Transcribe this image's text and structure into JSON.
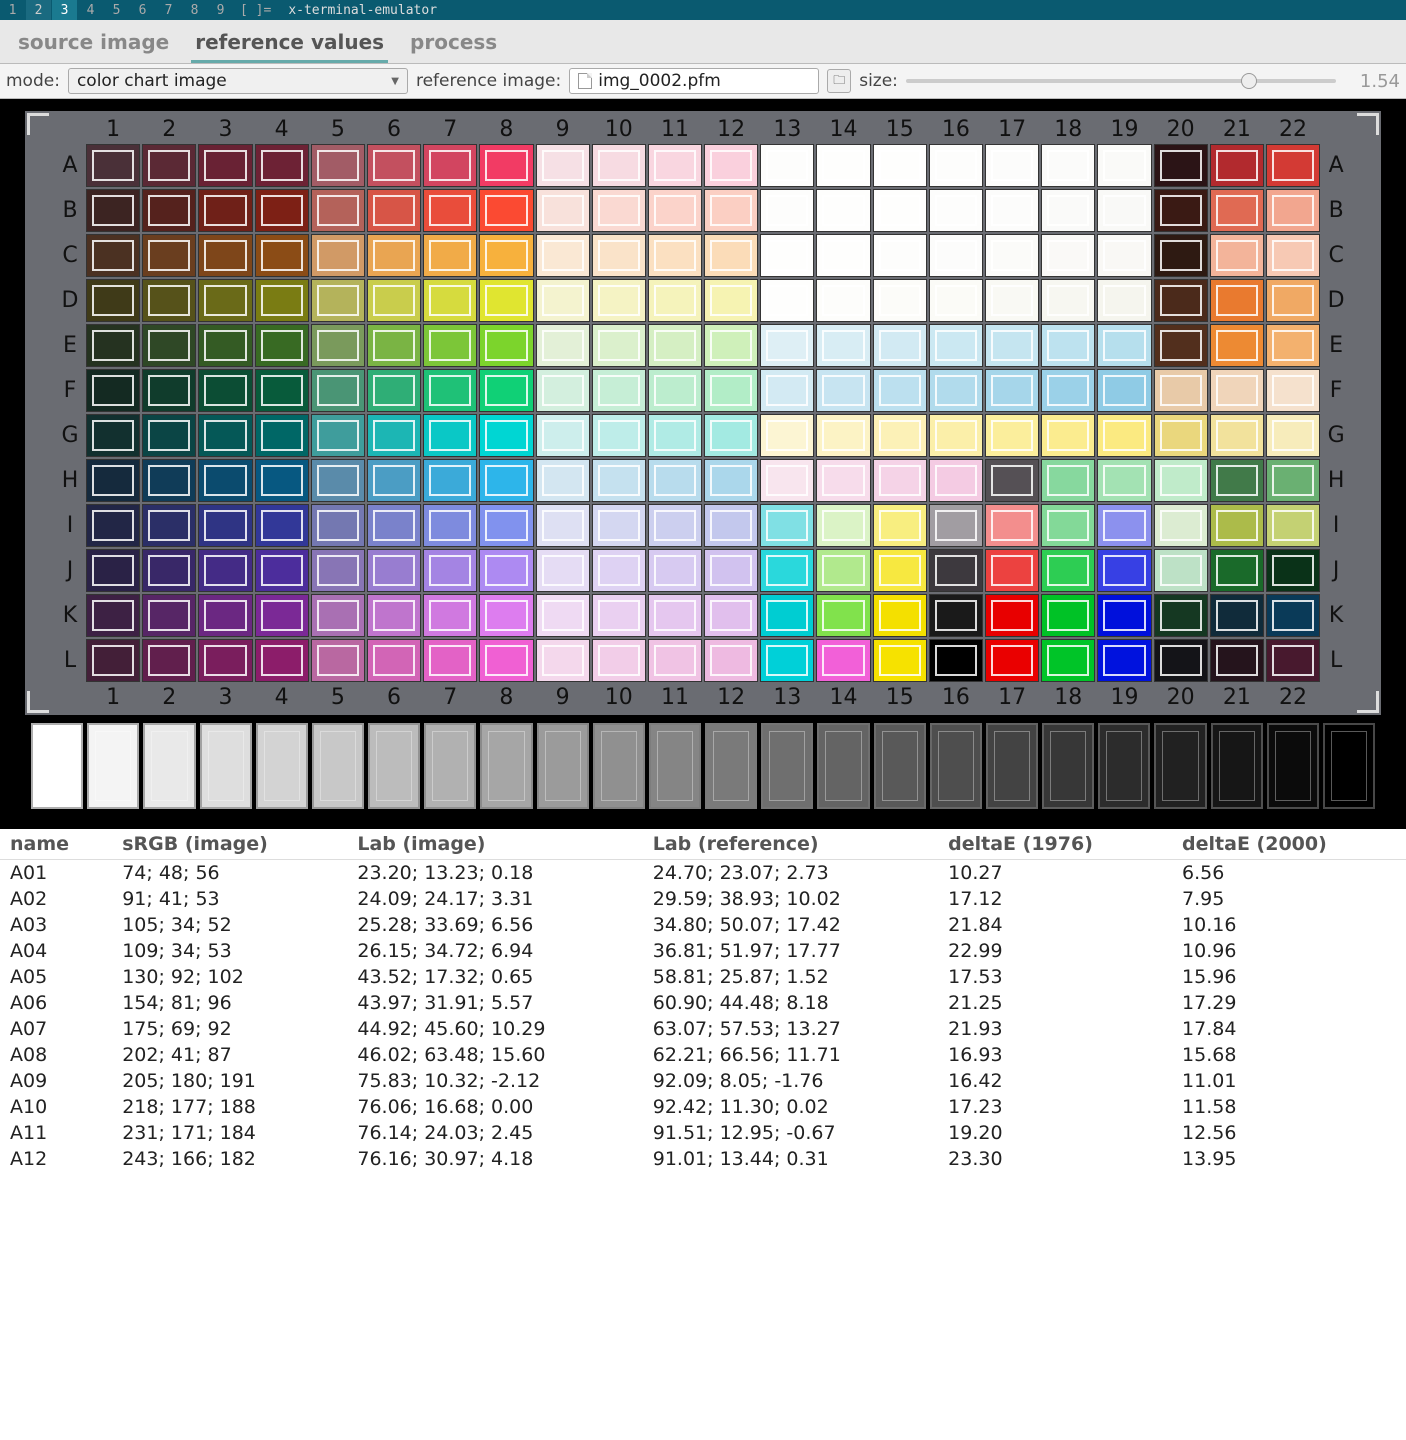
{
  "wm": {
    "workspaces": [
      "1",
      "2",
      "3",
      "4",
      "5",
      "6",
      "7",
      "8",
      "9",
      "[ ]="
    ],
    "active_index": 2,
    "marked_index": 1,
    "title": "x-terminal-emulator"
  },
  "tabs": {
    "items": [
      "source image",
      "reference values",
      "process"
    ],
    "active_index": 1
  },
  "toolbar": {
    "mode_label": "mode:",
    "mode_value": "color chart image",
    "ref_label": "reference image:",
    "ref_value": "img_0002.pfm",
    "size_label": "size:",
    "size_value": "1.54",
    "slider_pos_pct": 78
  },
  "chart": {
    "cols": [
      "1",
      "2",
      "3",
      "4",
      "5",
      "6",
      "7",
      "8",
      "9",
      "10",
      "11",
      "12",
      "13",
      "14",
      "15",
      "16",
      "17",
      "18",
      "19",
      "20",
      "21",
      "22"
    ],
    "rows": [
      "A",
      "B",
      "C",
      "D",
      "E",
      "F",
      "G",
      "H",
      "I",
      "J",
      "K",
      "L"
    ],
    "colors": [
      [
        "#4a3038",
        "#5b2935",
        "#692234",
        "#6d2235",
        "#a25c66",
        "#c3505f",
        "#d24560",
        "#f23b64",
        "#f6e0e5",
        "#f7dbe2",
        "#f9d6e0",
        "#fad0dd",
        "#fdfdfc",
        "#fefefd",
        "#fefefd",
        "#fdfdfc",
        "#fcfcfb",
        "#fbfbfa",
        "#fafaf8",
        "#2b1416",
        "#b22a2e",
        "#d33a34"
      ],
      [
        "#3c2422",
        "#55221d",
        "#6f2018",
        "#7d2015",
        "#b4625a",
        "#d75547",
        "#e94d3b",
        "#fb4a32",
        "#f8e1db",
        "#fad9d2",
        "#fbd3ca",
        "#fbcfc3",
        "#fdfdfc",
        "#fefefd",
        "#fefefd",
        "#fdfdfc",
        "#fcfcfb",
        "#fafaf9",
        "#f9f9f7",
        "#3a1a14",
        "#e06a53",
        "#f2a68f"
      ],
      [
        "#4b3122",
        "#6a3e1f",
        "#7e461a",
        "#8b4c16",
        "#d19a66",
        "#e9a552",
        "#f1ab48",
        "#f7b13d",
        "#fae8d4",
        "#fae3c9",
        "#fbe0c1",
        "#fbdcb8",
        "#fefefd",
        "#fefefd",
        "#fdfdfc",
        "#fcfcfb",
        "#fbfbf9",
        "#faf9f7",
        "#f9f8f5",
        "#2e1a12",
        "#f3b49a",
        "#f7c9b4"
      ],
      [
        "#3f3a18",
        "#56521a",
        "#6a6a18",
        "#7a7c13",
        "#b4b35b",
        "#c9cd4c",
        "#d6db3e",
        "#e0e530",
        "#f4f3cf",
        "#f5f3c4",
        "#f5f3bb",
        "#f6f3b2",
        "#fefefd",
        "#fdfdfb",
        "#fcfcf9",
        "#fbfbf7",
        "#f9f9f4",
        "#f7f7f1",
        "#f5f5ee",
        "#4b2a1b",
        "#e97a2f",
        "#f0a964"
      ],
      [
        "#253220",
        "#2f4826",
        "#345b24",
        "#386a23",
        "#7a9a5c",
        "#7ab444",
        "#7cc638",
        "#7cd42c",
        "#e3f0d7",
        "#dbf0cc",
        "#d5efc3",
        "#cff0ba",
        "#deeff5",
        "#d8edf4",
        "#d2eaf3",
        "#cbe8f2",
        "#c5e5f0",
        "#bde2ef",
        "#b6dfed",
        "#522f1d",
        "#ed8a33",
        "#f3b16e"
      ],
      [
        "#142a22",
        "#103c2c",
        "#0c4d34",
        "#085b3b",
        "#4a9575",
        "#2fae76",
        "#1fc177",
        "#10d076",
        "#d3efde",
        "#c6eed6",
        "#bcedce",
        "#b2edc7",
        "#d3eaf3",
        "#c7e4f1",
        "#bce0ef",
        "#b1dbec",
        "#a6d6ea",
        "#9bd1e8",
        "#8fcbe5",
        "#e8caa8",
        "#f0d5ba",
        "#f5e1cd"
      ],
      [
        "#12302f",
        "#0b4545",
        "#055857",
        "#006766",
        "#3f9d9c",
        "#1cb6b4",
        "#0ac8c6",
        "#00d6d3",
        "#cdeeec",
        "#beede9",
        "#b0ebe5",
        "#a3eae2",
        "#fcf5d3",
        "#fcf3c5",
        "#fcf1b7",
        "#fbefa9",
        "#fbee9c",
        "#fbec8f",
        "#fbea81",
        "#ead77d",
        "#f2e29c",
        "#f7ecbb"
      ],
      [
        "#152a3d",
        "#103c58",
        "#0b4b6e",
        "#075881",
        "#5a8baa",
        "#4b9dc4",
        "#3baad9",
        "#2db5ea",
        "#d3e6f1",
        "#c5e1ef",
        "#b8dced",
        "#abd7eb",
        "#f8e5ee",
        "#f7dceb",
        "#f5d3e7",
        "#f4cbe3",
        "#555055",
        "#87d89e",
        "#a3e2b3",
        "#c0ebca",
        "#417a49",
        "#6ab072"
      ],
      [
        "#222646",
        "#2b2f67",
        "#2f3484",
        "#323898",
        "#7478b1",
        "#7a82cb",
        "#7e8bde",
        "#8192ee",
        "#dee0f3",
        "#d4d7f1",
        "#cccfef",
        "#c3c8ed",
        "#80e0e4",
        "#dbf3c6",
        "#f8ee80",
        "#a19da2",
        "#f38e8d",
        "#83d998",
        "#8c91ee",
        "#dcecd2",
        "#acbb4a",
        "#c4d173"
      ],
      [
        "#2a2246",
        "#392868",
        "#442b86",
        "#4c2d9c",
        "#8875b5",
        "#987dd0",
        "#a484e3",
        "#ad8af2",
        "#e5dcf4",
        "#ded2f3",
        "#d7caf1",
        "#d1c2ef",
        "#2ad8dc",
        "#b1e98d",
        "#f7e840",
        "#3d393e",
        "#ec4240",
        "#2dcd53",
        "#3740e4",
        "#bde1c6",
        "#1a6a2a",
        "#0a3218"
      ],
      [
        "#3d2144",
        "#572666",
        "#6b2882",
        "#7b2996",
        "#a970b3",
        "#bf75cd",
        "#d079e0",
        "#dd7def",
        "#efdaf3",
        "#ead0f1",
        "#e5c7ef",
        "#e1bfed",
        "#00cdd2",
        "#81e24c",
        "#f4e000",
        "#1a1a1a",
        "#e80000",
        "#00c226",
        "#0010dc",
        "#153822",
        "#102b3a",
        "#0a3a58"
      ],
      [
        "#431f38",
        "#611f4d",
        "#7a1e5d",
        "#8c1d6a",
        "#b968a1",
        "#d265b6",
        "#e362c6",
        "#f060d3",
        "#f4d8ec",
        "#f2cde8",
        "#f0c3e4",
        "#eebae1",
        "#00d0d8",
        "#f260d8",
        "#f6e200",
        "#000000",
        "#ea0000",
        "#00c428",
        "#0012de",
        "#141418",
        "#25141c",
        "#48192e"
      ]
    ],
    "gray_strip_count": 24
  },
  "table": {
    "headers": [
      "name",
      "sRGB (image)",
      "Lab (image)",
      "Lab (reference)",
      "deltaE (1976)",
      "deltaE (2000)"
    ],
    "rows": [
      [
        "A01",
        "74; 48; 56",
        "23.20; 13.23; 0.18",
        "24.70; 23.07; 2.73",
        "10.27",
        "6.56"
      ],
      [
        "A02",
        "91; 41; 53",
        "24.09; 24.17; 3.31",
        "29.59; 38.93; 10.02",
        "17.12",
        "7.95"
      ],
      [
        "A03",
        "105; 34; 52",
        "25.28; 33.69; 6.56",
        "34.80; 50.07; 17.42",
        "21.84",
        "10.16"
      ],
      [
        "A04",
        "109; 34; 53",
        "26.15; 34.72; 6.94",
        "36.81; 51.97; 17.77",
        "22.99",
        "10.96"
      ],
      [
        "A05",
        "130; 92; 102",
        "43.52; 17.32; 0.65",
        "58.81; 25.87; 1.52",
        "17.53",
        "15.96"
      ],
      [
        "A06",
        "154; 81; 96",
        "43.97; 31.91; 5.57",
        "60.90; 44.48; 8.18",
        "21.25",
        "17.29"
      ],
      [
        "A07",
        "175; 69; 92",
        "44.92; 45.60; 10.29",
        "63.07; 57.53; 13.27",
        "21.93",
        "17.84"
      ],
      [
        "A08",
        "202; 41; 87",
        "46.02; 63.48; 15.60",
        "62.21; 66.56; 11.71",
        "16.93",
        "15.68"
      ],
      [
        "A09",
        "205; 180; 191",
        "75.83; 10.32; -2.12",
        "92.09; 8.05; -1.76",
        "16.42",
        "11.01"
      ],
      [
        "A10",
        "218; 177; 188",
        "76.06; 16.68; 0.00",
        "92.42; 11.30; 0.02",
        "17.23",
        "11.58"
      ],
      [
        "A11",
        "231; 171; 184",
        "76.14; 24.03; 2.45",
        "91.51; 12.95; -0.67",
        "19.20",
        "12.56"
      ],
      [
        "A12",
        "243; 166; 182",
        "76.16; 30.97; 4.18",
        "91.01; 13.44; 0.31",
        "23.30",
        "13.95"
      ]
    ]
  }
}
